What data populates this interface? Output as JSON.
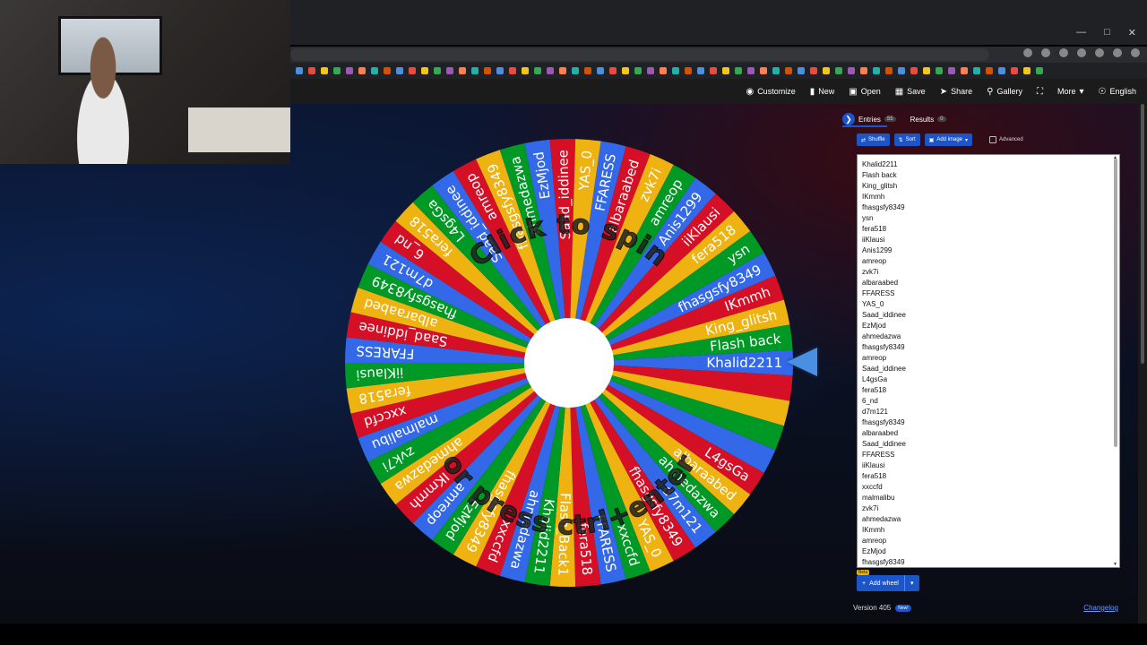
{
  "toolbar": {
    "customize": "Customize",
    "new": "New",
    "open": "Open",
    "save": "Save",
    "share": "Share",
    "gallery": "Gallery",
    "more": "More",
    "language": "English"
  },
  "wheel": {
    "top_text": "Click to spin",
    "bottom_text": "or press ctrl+enter",
    "colors": [
      "#3369e8",
      "#d50f25",
      "#eeb211",
      "#009925"
    ],
    "slice_labels": [
      "FFARESS",
      "albaraabed",
      "zvk7i",
      "amreop",
      "Anis1299",
      "iiKlausi",
      "fera518",
      "ysn",
      "fhasgsfy8349",
      "IKmmh",
      "King_glitsh",
      "Flash back",
      "Khalid2211",
      "",
      "",
      "",
      "",
      "L4gsGa",
      "albaraabed",
      "ahmedazwa",
      "d7m121",
      "fhasgsfy8349",
      "YAS_0",
      "xxccfd",
      "FFARESS",
      "fera518",
      "Flash_Back1",
      "Khalid2211",
      "ahmedazwa",
      "xxccfd",
      "fhasgsfy8349",
      "EzMjod",
      "amreop",
      "IKmmh",
      "ahmedazwa",
      "zvk7i",
      "malmalibu",
      "xxccfd",
      "fera518",
      "iiKlausi",
      "FFARESS",
      "Saad_iddinee",
      "albaraabed",
      "fhasgsfy8349",
      "d7m121",
      "6_nd",
      "fera518",
      "L4gsGa",
      "Saad_iddinee",
      "amreop",
      "fhasgsfy8349",
      "ahmedazwa",
      "EzMjod",
      "Saad_iddinee",
      "YAS_0"
    ]
  },
  "panel": {
    "tab_entries": "Entries",
    "entries_count": "55",
    "tab_results": "Results",
    "results_count": "0",
    "shuffle": "Shuffle",
    "sort": "Sort",
    "add_image": "Add image",
    "advanced": "Advanced",
    "entries": [
      "Khalid2211",
      "Flash back",
      "King_glitsh",
      "IKmmh",
      "fhasgsfy8349",
      "ysn",
      "fera518",
      "iiKlausi",
      "Anis1299",
      "amreop",
      "zvk7i",
      "albaraabed",
      "FFARESS",
      "YAS_0",
      "Saad_iddinee",
      "EzMjod",
      "ahmedazwa",
      "fhasgsfy8349",
      "amreop",
      "Saad_iddinee",
      "L4gsGa",
      "fera518",
      "6_nd",
      "d7m121",
      "fhasgsfy8349",
      "albaraabed",
      "Saad_iddinee",
      "FFARESS",
      "iiKlausi",
      "fera518",
      "xxccfd",
      "malmalibu",
      "zvk7i",
      "ahmedazwa",
      "IKmmh",
      "amreop",
      "EzMjod",
      "fhasgsfy8349"
    ],
    "beta": "Beta",
    "add_wheel": "Add wheel",
    "version": "Version 405",
    "new_badge": "New!",
    "changelog": "Changelog"
  }
}
